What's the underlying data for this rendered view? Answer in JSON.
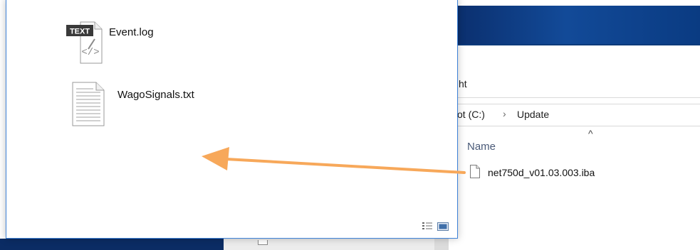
{
  "background_explorer": {
    "ribbon_tab_partial": "ht",
    "address": {
      "drive_partial": "ot (C:)",
      "separator": "›",
      "folder": "Update"
    },
    "sort_indicator": "^",
    "column_header": "Name",
    "files": [
      {
        "name": "net750d_v01.03.003.iba",
        "icon": "document-icon"
      }
    ]
  },
  "foreground_explorer": {
    "files": [
      {
        "name": "Event.log",
        "icon": "text-file-icon",
        "badge": "TEXT"
      },
      {
        "name": "WagoSignals.txt",
        "icon": "text-document-icon"
      }
    ],
    "view_buttons": [
      "details-view-icon",
      "large-icons-view-icon"
    ]
  },
  "overlay": {
    "arrow_color": "#f7a85a",
    "direction": "drag-to-left"
  },
  "colors": {
    "desktop_blue": "#0b2f6e",
    "window_border": "#3f83d9"
  }
}
